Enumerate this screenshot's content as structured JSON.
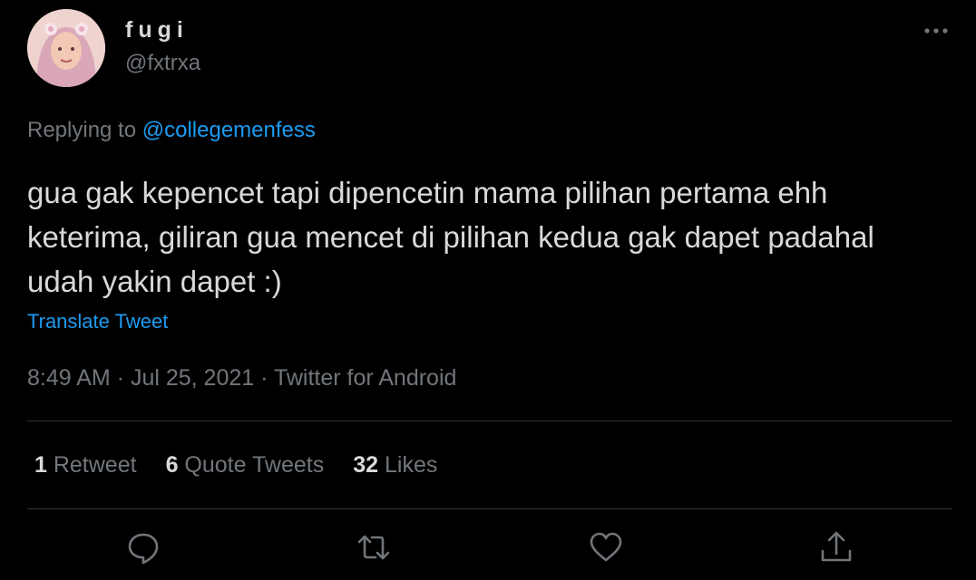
{
  "author": {
    "display_name": "fugi",
    "handle": "@fxtrxa",
    "avatar_icon": "profile-photo"
  },
  "reply": {
    "prefix": "Replying to ",
    "mention": "@collegemenfess"
  },
  "tweet": {
    "text": "gua gak kepencet tapi dipencetin mama pilihan pertama ehh keterima, giliran gua mencet di pilihan kedua gak dapet padahal udah yakin dapet :)",
    "translate_label": "Translate Tweet"
  },
  "meta": {
    "time": "8:49 AM",
    "separator1": " · ",
    "date": "Jul 25, 2021",
    "separator2": " · ",
    "source": "Twitter for Android"
  },
  "stats": {
    "retweets_count": "1",
    "retweets_label": " Retweet",
    "quotes_count": "6",
    "quotes_label": " Quote Tweets",
    "likes_count": "32",
    "likes_label": " Likes"
  },
  "actions": [
    "reply-icon",
    "retweet-icon",
    "like-icon",
    "share-icon"
  ],
  "colors": {
    "background": "#000000",
    "text": "#d9d9d9",
    "secondary": "#71767b",
    "accent": "#1d9bf0",
    "divider": "#2f3336"
  }
}
